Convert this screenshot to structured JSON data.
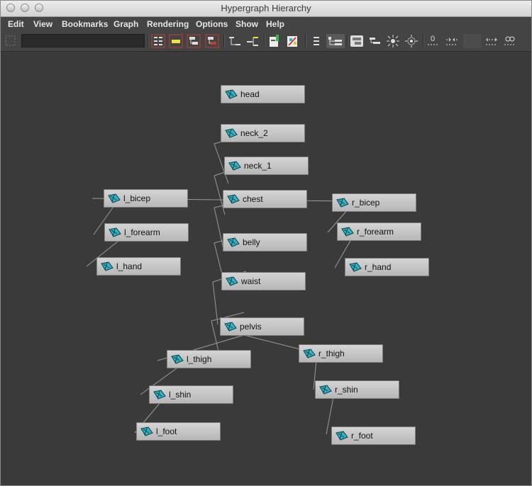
{
  "window": {
    "title": "Hypergraph Hierarchy"
  },
  "menu": [
    "Edit",
    "View",
    "Bookmarks",
    "Graph",
    "Rendering",
    "Options",
    "Show",
    "Help"
  ],
  "toolbar": {
    "search_value": "",
    "icons": [
      "filter-icon",
      "select-tree-icon",
      "select-node-icon",
      "select-children-icon",
      "select-hierarchy-icon",
      "graph-up-icon",
      "graph-down-icon",
      "add-bookmark-icon",
      "bookmark-editor-icon",
      "list-view-icon",
      "hierarchy-view-icon",
      "scene-hierarchy-icon",
      "input-output-icon",
      "frame-all-icon",
      "frame-selection-icon",
      "layout-icon",
      "connections-icon",
      "expand-icon",
      "collapse-icon",
      "disconnect-icon"
    ]
  },
  "nodes": {
    "head": "head",
    "neck_2": "neck_2",
    "neck_1": "neck_1",
    "chest": "chest",
    "l_bicep": "l_bicep",
    "l_forearm": "l_forearm",
    "l_hand": "l_hand",
    "r_bicep": "r_bicep",
    "r_forearm": "r_forearm",
    "r_hand": "r_hand",
    "belly": "belly",
    "waist": "waist",
    "pelvis": "pelvis",
    "l_thigh": "l_thigh",
    "l_shin": "l_shin",
    "l_foot": "l_foot",
    "r_thigh": "r_thigh",
    "r_shin": "r_shin",
    "r_foot": "r_foot"
  },
  "colors": {
    "canvas": "#3a3a3a",
    "node": "#c4c4c4",
    "edge": "#9a9a9a",
    "icon": "#2bb3c6"
  }
}
